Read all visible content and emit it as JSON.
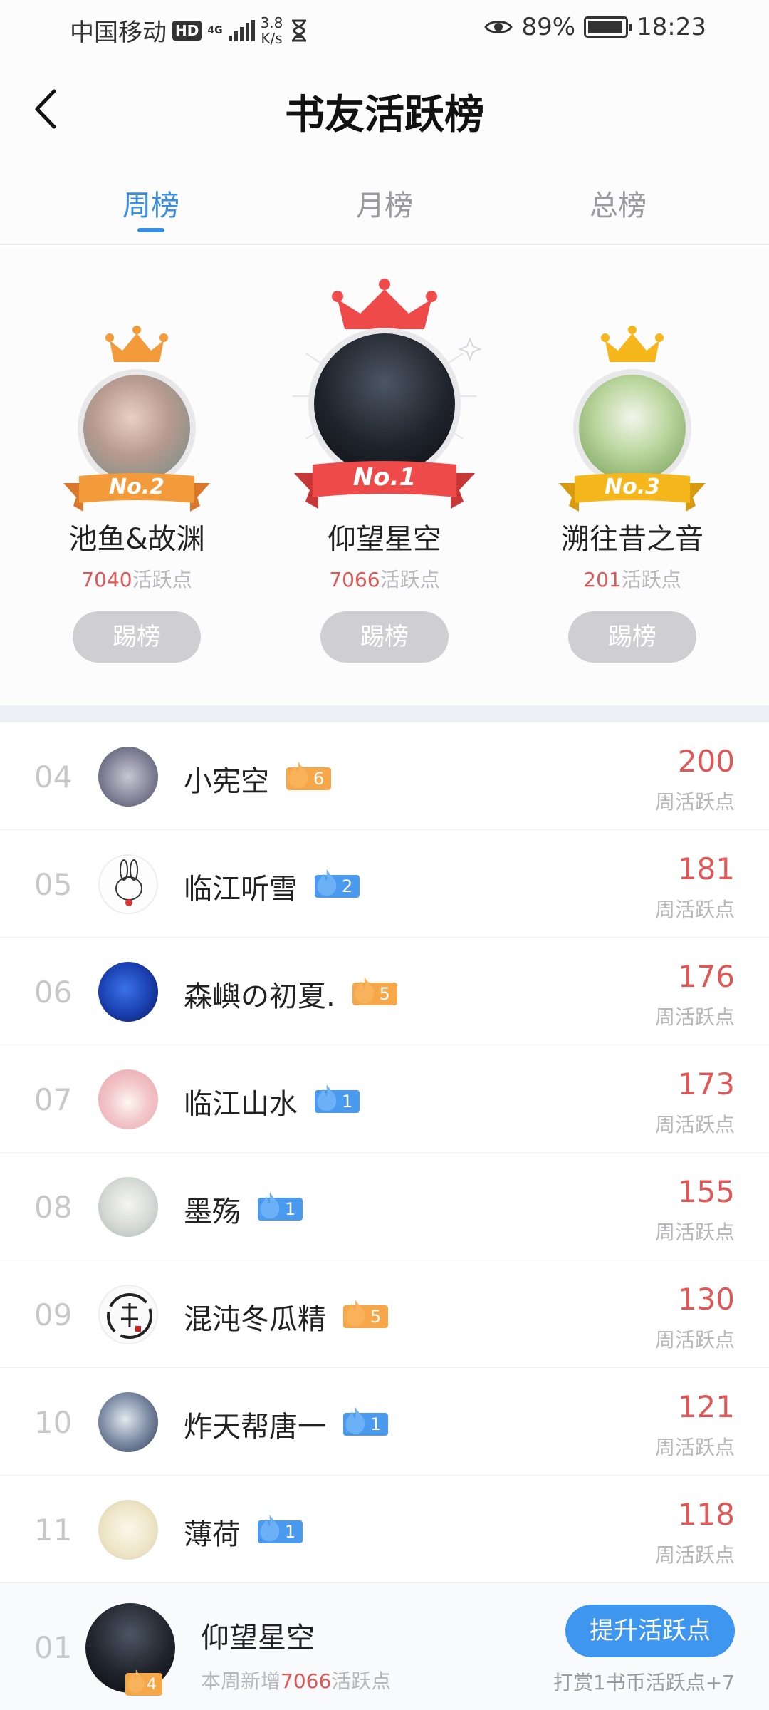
{
  "status_bar": {
    "carrier": "中国移动",
    "hd": "HD",
    "network": "4G",
    "speed": "3.8",
    "speed_unit": "K/s",
    "battery": "89%",
    "time": "18:23"
  },
  "header": {
    "title": "书友活跃榜"
  },
  "tabs": [
    {
      "label": "周榜",
      "active": true
    },
    {
      "label": "月榜",
      "active": false
    },
    {
      "label": "总榜",
      "active": false
    }
  ],
  "podium": [
    {
      "place_label": "No.2",
      "name": "池鱼&故渊",
      "points": "7040",
      "unit": "活跃点",
      "button": "踢榜",
      "crown_color": "#f39a3a",
      "ribbon_color": "#f39a3a"
    },
    {
      "place_label": "No.1",
      "name": "仰望星空",
      "points": "7066",
      "unit": "活跃点",
      "button": "踢榜",
      "crown_color": "#ee4a4a",
      "ribbon_color": "#ee4a4a"
    },
    {
      "place_label": "No.3",
      "name": "溯往昔之音",
      "points": "201",
      "unit": "活跃点",
      "button": "踢榜",
      "crown_color": "#f6b71c",
      "ribbon_color": "#f6b71c"
    }
  ],
  "ranking": [
    {
      "rank": "04",
      "name": "小宪空",
      "level": "6",
      "badge": "orange",
      "value": "200",
      "unit": "周活跃点"
    },
    {
      "rank": "05",
      "name": "临江听雪",
      "level": "2",
      "badge": "blue",
      "value": "181",
      "unit": "周活跃点"
    },
    {
      "rank": "06",
      "name": "森嶼の初夏.",
      "level": "5",
      "badge": "orange",
      "value": "176",
      "unit": "周活跃点"
    },
    {
      "rank": "07",
      "name": "临江山水",
      "level": "1",
      "badge": "blue",
      "value": "173",
      "unit": "周活跃点"
    },
    {
      "rank": "08",
      "name": "墨殇",
      "level": "1",
      "badge": "blue",
      "value": "155",
      "unit": "周活跃点"
    },
    {
      "rank": "09",
      "name": "混沌冬瓜精",
      "level": "5",
      "badge": "orange",
      "value": "130",
      "unit": "周活跃点"
    },
    {
      "rank": "10",
      "name": "炸天帮唐一",
      "level": "1",
      "badge": "blue",
      "value": "121",
      "unit": "周活跃点"
    },
    {
      "rank": "11",
      "name": "薄荷",
      "level": "1",
      "badge": "blue",
      "value": "118",
      "unit": "周活跃点"
    }
  ],
  "me": {
    "rank": "01",
    "name": "仰望星空",
    "level": "4",
    "sub_prefix": "本周新增",
    "sub_value": "7066",
    "sub_suffix": "活跃点",
    "button": "提升活跃点",
    "hint": "打赏1书币活跃点+7"
  },
  "colors": {
    "accent_blue": "#3b8fe0",
    "points_red": "#e05757",
    "badge_orange": "#f5a74a",
    "badge_blue": "#4a9bef"
  }
}
